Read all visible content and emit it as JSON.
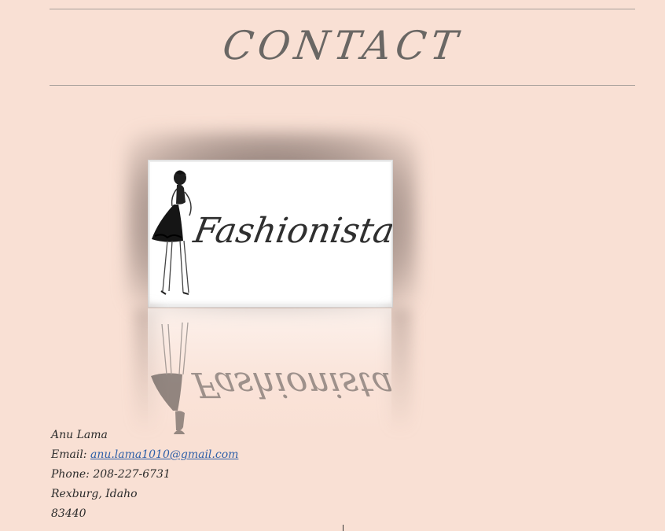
{
  "heading": "CONTACT",
  "image": {
    "brand_text": "Fashionista",
    "icon": "fashion-sketch-illustration"
  },
  "contact": {
    "name": "Anu Lama",
    "email_label": "Email: ",
    "email": "anu.lama1010@gmail.com",
    "phone": "Phone: 208-227-6731",
    "city": "Rexburg, Idaho",
    "zip": "83440"
  },
  "colors": {
    "background": "#f9e0d4",
    "heading": "#6a6764",
    "link": "#2e5fa8",
    "rule": "#a9a19c"
  }
}
